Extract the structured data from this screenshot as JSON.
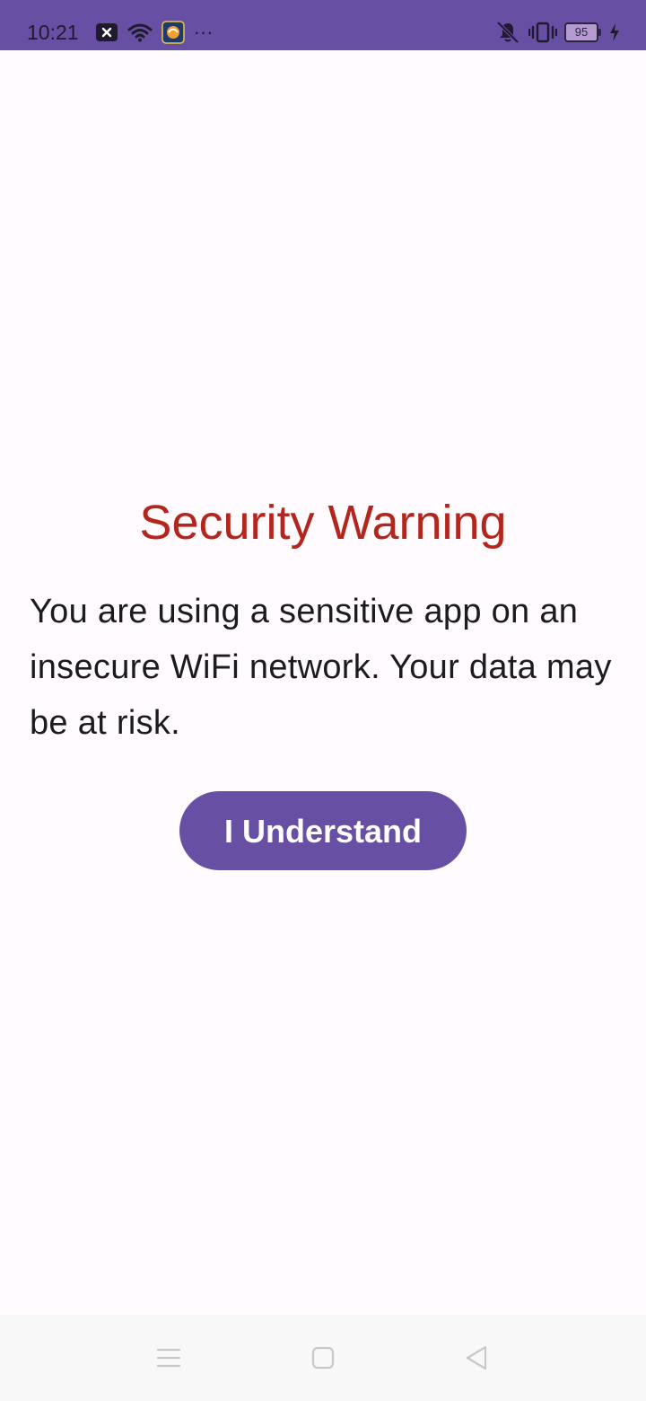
{
  "status_bar": {
    "time": "10:21",
    "battery_level": "95",
    "overflow": "···",
    "icons": [
      "close-notification-icon",
      "wifi-icon",
      "app-notification-icon",
      "vibrate-mute-icon",
      "vibrate-icon",
      "battery-icon",
      "charging-icon"
    ],
    "background_color": "#6750a4"
  },
  "dialog": {
    "title": "Security Warning",
    "message": "You are using a sensitive app on an insecure WiFi network. Your data may be at risk.",
    "button_label": "I Understand",
    "title_color": "#b3261e",
    "button_color": "#6750a4"
  },
  "nav_bar": {
    "buttons": [
      "menu-icon",
      "home-icon",
      "back-icon"
    ]
  }
}
